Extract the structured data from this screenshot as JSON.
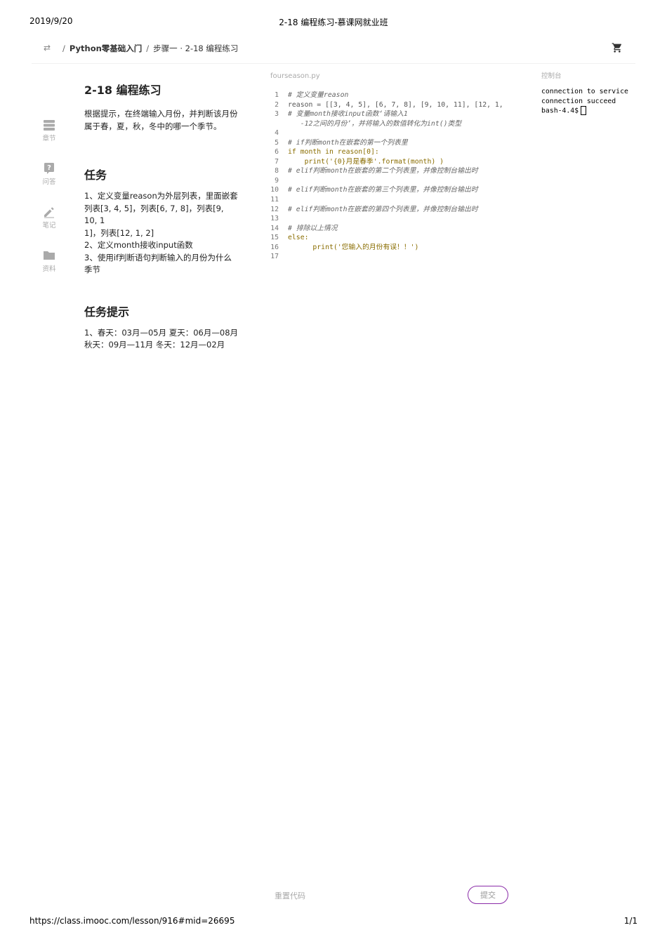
{
  "print_header": {
    "date": "2019/9/20",
    "title": "2-18 编程练习-慕课网就业班"
  },
  "print_footer": {
    "url": "https://class.imooc.com/lesson/916#mid=26695",
    "page": "1/1"
  },
  "breadcrumb": {
    "course": "Python零基础入门",
    "step": "步骤一 · 2-18 编程练习",
    "separator": "/"
  },
  "sidebar": {
    "items": [
      {
        "label": "章节",
        "icon": "chapter-icon"
      },
      {
        "label": "问答",
        "icon": "question-icon"
      },
      {
        "label": "笔记",
        "icon": "pencil-icon"
      },
      {
        "label": "资料",
        "icon": "folder-icon"
      }
    ]
  },
  "task": {
    "title": "2-18 编程练习",
    "description_lines": [
      "根据提示，在终端输入月份，并判断该月份",
      "属于春，夏，秋，冬中的哪一个季节。"
    ],
    "mission_heading": "任务",
    "mission_lines": [
      "1、定义变量reason为外层列表，里面嵌套",
      "列表[3, 4, 5]，列表[6, 7, 8]，列表[9, 10, 1",
      "1]，列表[12, 1, 2]",
      "2、定义month接收input函数",
      "3、使用if判断语句判断输入的月份为什么",
      "季节"
    ],
    "hint_heading": "任务提示",
    "hint_lines": [
      "1、春天：03月—05月 夏天：06月—08月",
      "秋天：09月—11月 冬天：12月—02月"
    ]
  },
  "editor": {
    "filename": "fourseason.py",
    "lines": [
      {
        "n": "1",
        "text": "# 定义变量reason"
      },
      {
        "n": "2",
        "text": "reason = [[3, 4, 5], [6, 7, 8], [9, 10, 11], [12, 1,"
      },
      {
        "n": "3",
        "text": "# 变量month接收input函数‘请输入1"
      },
      {
        "n": "",
        "text": "   -12之间的月份’，并将输入的数值转化为int()类型"
      },
      {
        "n": "4",
        "text": ""
      },
      {
        "n": "5",
        "text": "# if判断month在嵌套的第一个列表里"
      },
      {
        "n": "6",
        "text": "if month in reason[0]:"
      },
      {
        "n": "7",
        "text": "    print('{0}月是春季'.format(month) )"
      },
      {
        "n": "8",
        "text": "# elif判断month在嵌套的第二个列表里，并像控制台输出时"
      },
      {
        "n": "9",
        "text": ""
      },
      {
        "n": "10",
        "text": "# elif判断month在嵌套的第三个列表里，并像控制台输出时"
      },
      {
        "n": "11",
        "text": ""
      },
      {
        "n": "12",
        "text": "# elif判断month在嵌套的第四个列表里，并像控制台输出时"
      },
      {
        "n": "13",
        "text": ""
      },
      {
        "n": "14",
        "text": "# 排除以上情况"
      },
      {
        "n": "15",
        "text": "else:"
      },
      {
        "n": "16",
        "text": "      print('您输入的月份有误！！')"
      },
      {
        "n": "17",
        "text": ""
      }
    ]
  },
  "console": {
    "title": "控制台",
    "lines": [
      "connection to service",
      "connection succeed"
    ],
    "prompt": "bash-4.4$"
  },
  "actions": {
    "reset_label": "重置代码",
    "submit_label": "提交"
  },
  "colors": {
    "accent": "#8a2ba8",
    "muted": "#aaaaaa"
  }
}
